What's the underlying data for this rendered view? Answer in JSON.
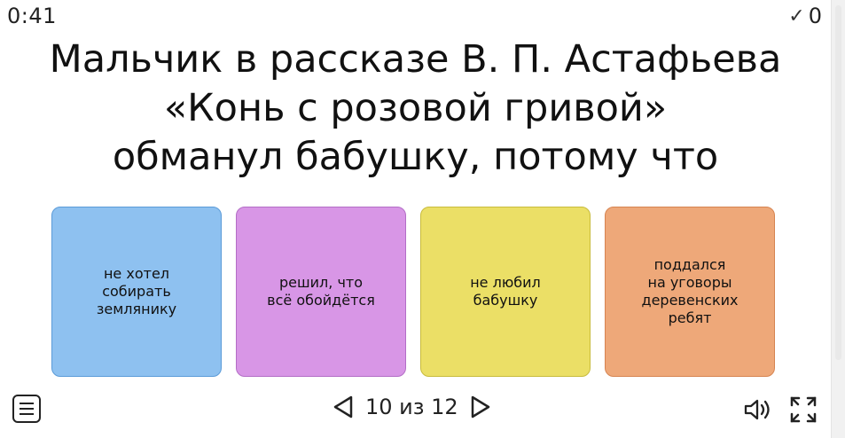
{
  "header": {
    "timer": "0:41",
    "score": "0"
  },
  "question": {
    "text": "Мальчик в рассказе В. П. Астафьева\n«Конь с розовой гривой»\nобманул бабушку, потому что"
  },
  "answers": [
    {
      "label": "не хотел\nсобирать\nземлянику",
      "color": "#8ec1f0",
      "border": "#5b9bd8"
    },
    {
      "label": "решил, что\nвсё обойдётся",
      "color": "#d896e6",
      "border": "#b36ec6"
    },
    {
      "label": "не любил\nбабушку",
      "color": "#ebdf66",
      "border": "#c8bb3c"
    },
    {
      "label": "поддался\nна уговоры\nдеревенских\nребят",
      "color": "#eea879",
      "border": "#d68451"
    }
  ],
  "footer": {
    "page_info": "10 из 12"
  },
  "icons": {
    "check": "check-icon",
    "menu": "menu-icon",
    "prev": "triangle-left-icon",
    "next": "triangle-right-icon",
    "sound": "speaker-icon",
    "fullscreen": "fullscreen-icon"
  }
}
